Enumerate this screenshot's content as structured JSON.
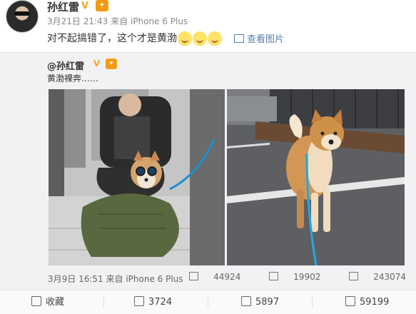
{
  "post": {
    "author": "孙红雷",
    "time": "3月21日 21:43",
    "source_prefix": "来自",
    "source": "iPhone 6 Plus",
    "text": "对不起搞错了，这个才是黄渤",
    "view_image_label": "查看图片"
  },
  "repost": {
    "author": "@孙红雷",
    "text": "黄渤裸奔……",
    "time": "3月9日 16:51",
    "source_prefix": "来自",
    "source": "iPhone 6 Plus",
    "reposts": "44924",
    "comments": "19902",
    "likes": "243074"
  },
  "actions": {
    "favorite": "收藏",
    "repost": "3724",
    "comment": "5897",
    "like": "59199"
  },
  "icons": {
    "verified": "verified-v-icon",
    "medal": "medal-icon",
    "emoji": "smile-emoji-icon"
  },
  "colors": {
    "link": "#5a7fa8",
    "verified": "#f5a623"
  }
}
